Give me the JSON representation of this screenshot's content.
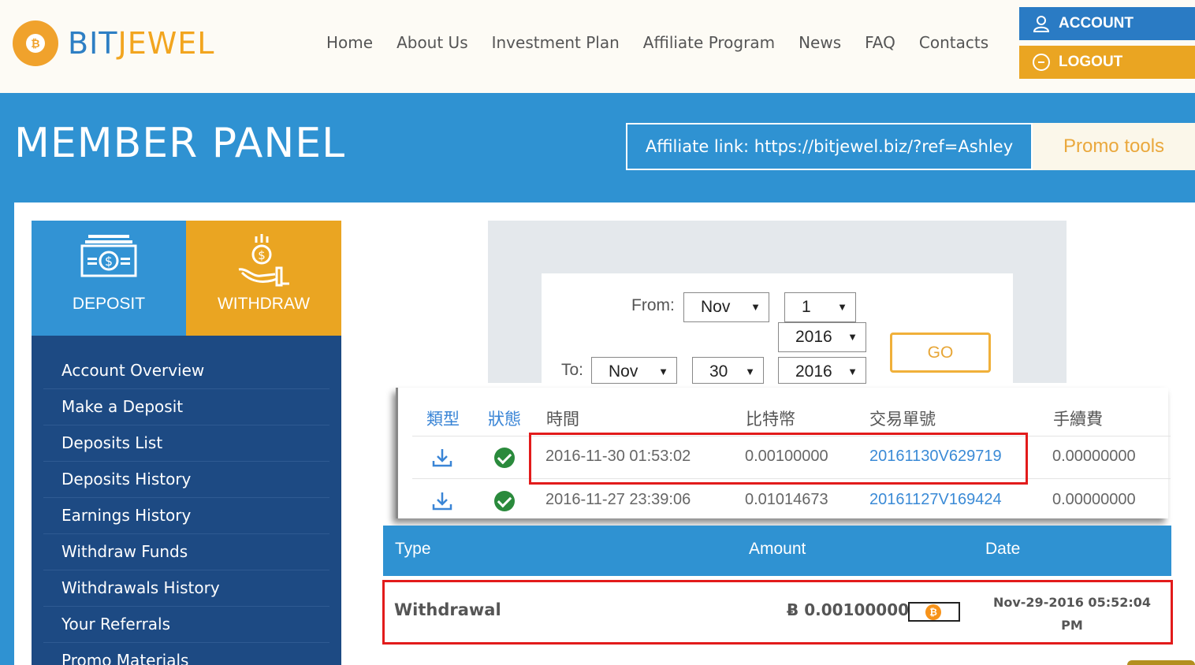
{
  "brand": {
    "name_part1": "BIT",
    "name_part2": "JEWEL",
    "coin_symbol": "₿"
  },
  "nav": [
    "Home",
    "About Us",
    "Investment Plan",
    "Affiliate Program",
    "News",
    "FAQ",
    "Contacts"
  ],
  "header_buttons": {
    "account": "ACCOUNT",
    "logout": "LOGOUT"
  },
  "panel": {
    "title": "MEMBER PANEL",
    "affiliate_link": "Affiliate link: https://bitjewel.biz/?ref=Ashley",
    "promo_tools": "Promo tools"
  },
  "tiles": {
    "deposit": "DEPOSIT",
    "withdraw": "WITHDRAW"
  },
  "menu": [
    "Account Overview",
    "Make a Deposit",
    "Deposits List",
    "Deposits History",
    "Earnings History",
    "Withdraw Funds",
    "Withdrawals History",
    "Your Referrals",
    "Promo Materials"
  ],
  "filter": {
    "from_label": "From:",
    "to_label": "To:",
    "from_month": "Nov",
    "from_day": "1",
    "from_year": "2016",
    "to_month": "Nov",
    "to_day": "30",
    "to_year": "2016",
    "go": "GO"
  },
  "wallet_table": {
    "headers": [
      "類型",
      "狀態",
      "時間",
      "比特幣",
      "交易單號",
      "手續費"
    ],
    "rows": [
      {
        "time": "2016-11-30 01:53:02",
        "btc": "0.00100000",
        "txid": "20161130V629719",
        "fee": "0.00000000"
      },
      {
        "time": "2016-11-27 23:39:06",
        "btc": "0.01014673",
        "txid": "20161127V169424",
        "fee": "0.00000000"
      }
    ]
  },
  "history_table": {
    "headers": {
      "type": "Type",
      "amount": "Amount",
      "date": "Date"
    },
    "row": {
      "type": "Withdrawal",
      "amount": "Ƀ 0.00100000",
      "date_line1": "Nov-29-2016 05:52:04",
      "date_line2": "PM"
    }
  },
  "colors": {
    "primary_blue": "#2f92d2",
    "dark_blue": "#1d4a83",
    "orange": "#eaa522",
    "highlight_red": "#e21b1b"
  }
}
